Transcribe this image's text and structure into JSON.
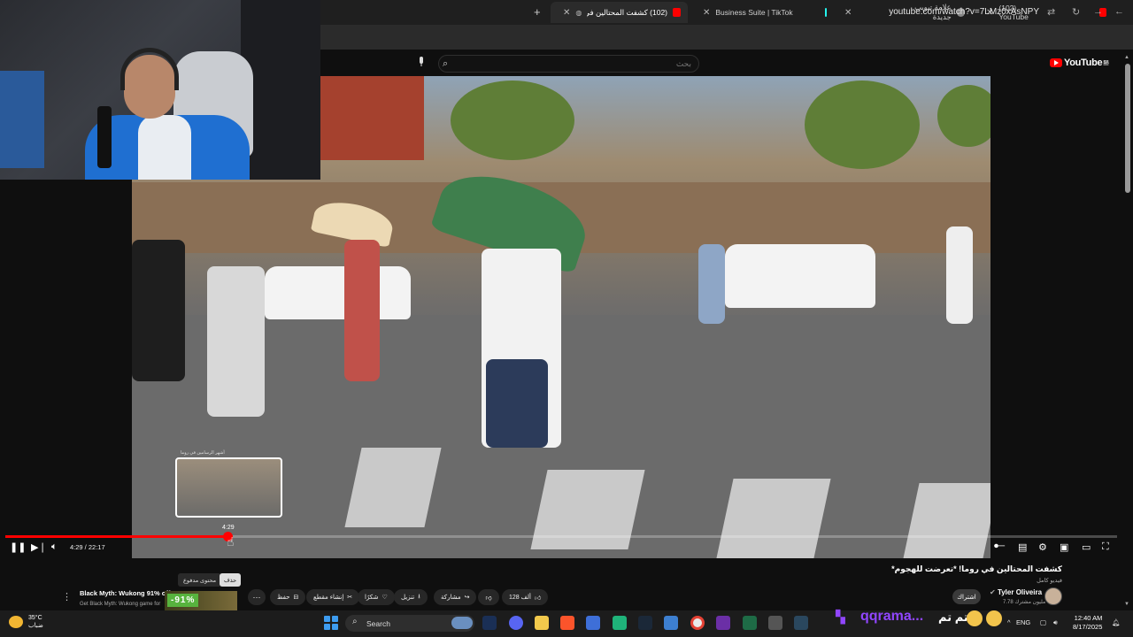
{
  "browser": {
    "tabs": [
      {
        "label": "(102) كشفت المحتالين في ر",
        "active": true
      },
      {
        "label": "Business Suite | TikTok",
        "active": false
      },
      {
        "label": "علامة تبويب جديدة",
        "active": false
      },
      {
        "label": "(102) YouTube",
        "active": false
      }
    ],
    "url": "youtube.com/watch?v=7LMz0xAsNPY"
  },
  "youtube": {
    "logo": "YouTube",
    "logo_region": "SA",
    "search_placeholder": "بحث"
  },
  "player": {
    "time_current": "4:29",
    "time_total": "22:17",
    "time_display": "4:29 / 22:17",
    "hover_time": "4:29",
    "progress_fraction": 0.2,
    "thumb_caption": "أشهر الرسامين في روما"
  },
  "video": {
    "title": "كشفت المحتالين في روما! *تعرضت للهجوم*",
    "badge": "فيديو كامل",
    "channel": "Tyler Oliveira",
    "subscribers": "7.78 مليون مشترك",
    "subscribe_label": "اشتراك",
    "likes": "128 ألف",
    "share_label": "مشاركة",
    "download_label": "تنزيل",
    "thanks_label": "شكرًا",
    "clip_label": "إنشاء مقطع",
    "save_label": "حفظ",
    "tooltip_label": "محتوى مدفوع",
    "tooltip2_label": "حذف"
  },
  "ad": {
    "title": "Black Myth: Wukong 91% off",
    "subtitle": "Get Black Myth: Wukong game for",
    "discount": "-91%"
  },
  "taskbar": {
    "temperature": "35°C",
    "weather_desc": "ضباب",
    "search_label": "Search",
    "language": "ENG",
    "time": "12:40 AM",
    "date": "8/17/2025",
    "twitch_name": "qqrama...",
    "emote_text": "تم تم"
  },
  "colors": {
    "accent": "#ff0000",
    "background": "#0f0f0f",
    "twitch": "#9146ff"
  }
}
